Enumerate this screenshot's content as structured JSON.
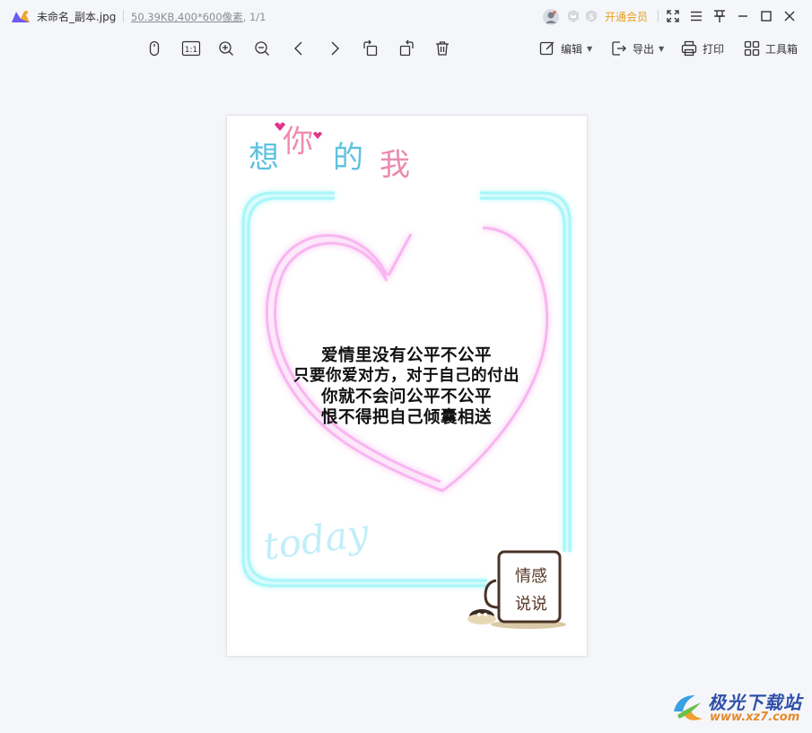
{
  "titlebar": {
    "file_name": "未命名_副本.jpg",
    "file_size": "50.39KB",
    "dimensions": ",400*600像素",
    "page_index": "1/1",
    "vip_label": "开通会员"
  },
  "toolbar": {
    "edit_label": "编辑",
    "export_label": "导出",
    "print_label": "打印",
    "toolbox_label": "工具箱",
    "actual_size_label": "1:1"
  },
  "image": {
    "title_art": "想你的我",
    "poem_lines": [
      "爱情里没有公平不公平",
      "只要你爱对方，对于自己的付出",
      "你就不会问公平不公平",
      "恨不得把自己倾囊相送"
    ],
    "script_word": "today",
    "mug_lines": [
      "情感",
      "说说"
    ]
  },
  "watermark": {
    "name": "极光下载站",
    "url": "www.xz7.com"
  },
  "colors": {
    "accent_orange": "#e8a11a",
    "neon_cyan": "#8ff3f6",
    "neon_pink": "#f6a6ee",
    "canvas_bg": "#f5f6fa"
  }
}
